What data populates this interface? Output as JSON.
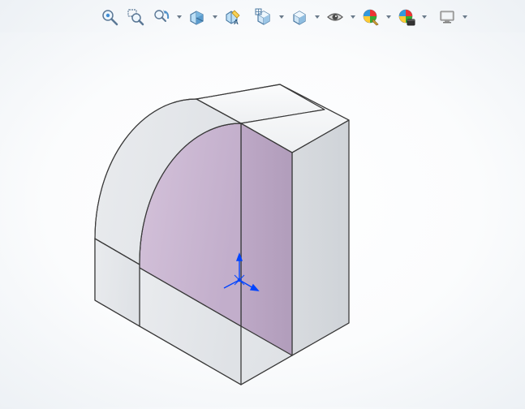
{
  "toolbar": {
    "items": [
      {
        "name": "zoom-to-fit-icon",
        "tooltip": "Zoom to Fit",
        "dropdown": false
      },
      {
        "name": "zoom-to-area-icon",
        "tooltip": "Zoom to Area",
        "dropdown": false
      },
      {
        "name": "previous-view-icon",
        "tooltip": "Previous View",
        "dropdown": true
      },
      {
        "name": "section-view-icon",
        "tooltip": "Section View",
        "dropdown": true
      },
      {
        "name": "dynamic-annotate-icon",
        "tooltip": "Dynamic Annotation Views",
        "dropdown": false
      },
      {
        "name": "view-orientation-icon",
        "tooltip": "View Orientation",
        "dropdown": true
      },
      {
        "name": "display-style-icon",
        "tooltip": "Display Style",
        "dropdown": true
      },
      {
        "name": "hide-show-icon",
        "tooltip": "Hide/Show Items",
        "dropdown": true
      },
      {
        "name": "edit-appearance-icon",
        "tooltip": "Edit Appearance",
        "dropdown": true
      },
      {
        "name": "apply-scene-icon",
        "tooltip": "Apply Scene",
        "dropdown": true
      },
      {
        "name": "view-settings-icon",
        "tooltip": "View Settings",
        "dropdown": true
      }
    ]
  },
  "model": {
    "origin_triad": {
      "axes": [
        "X",
        "Y",
        "Z"
      ],
      "color": "#0044ff"
    },
    "section_face_color": "#cbb6d1",
    "body_face_color_light": "#f2f3f4",
    "body_face_color_mid": "#e3e5e8",
    "body_face_color_dark": "#d2d5d9",
    "edge_color": "#3a3a3a"
  }
}
